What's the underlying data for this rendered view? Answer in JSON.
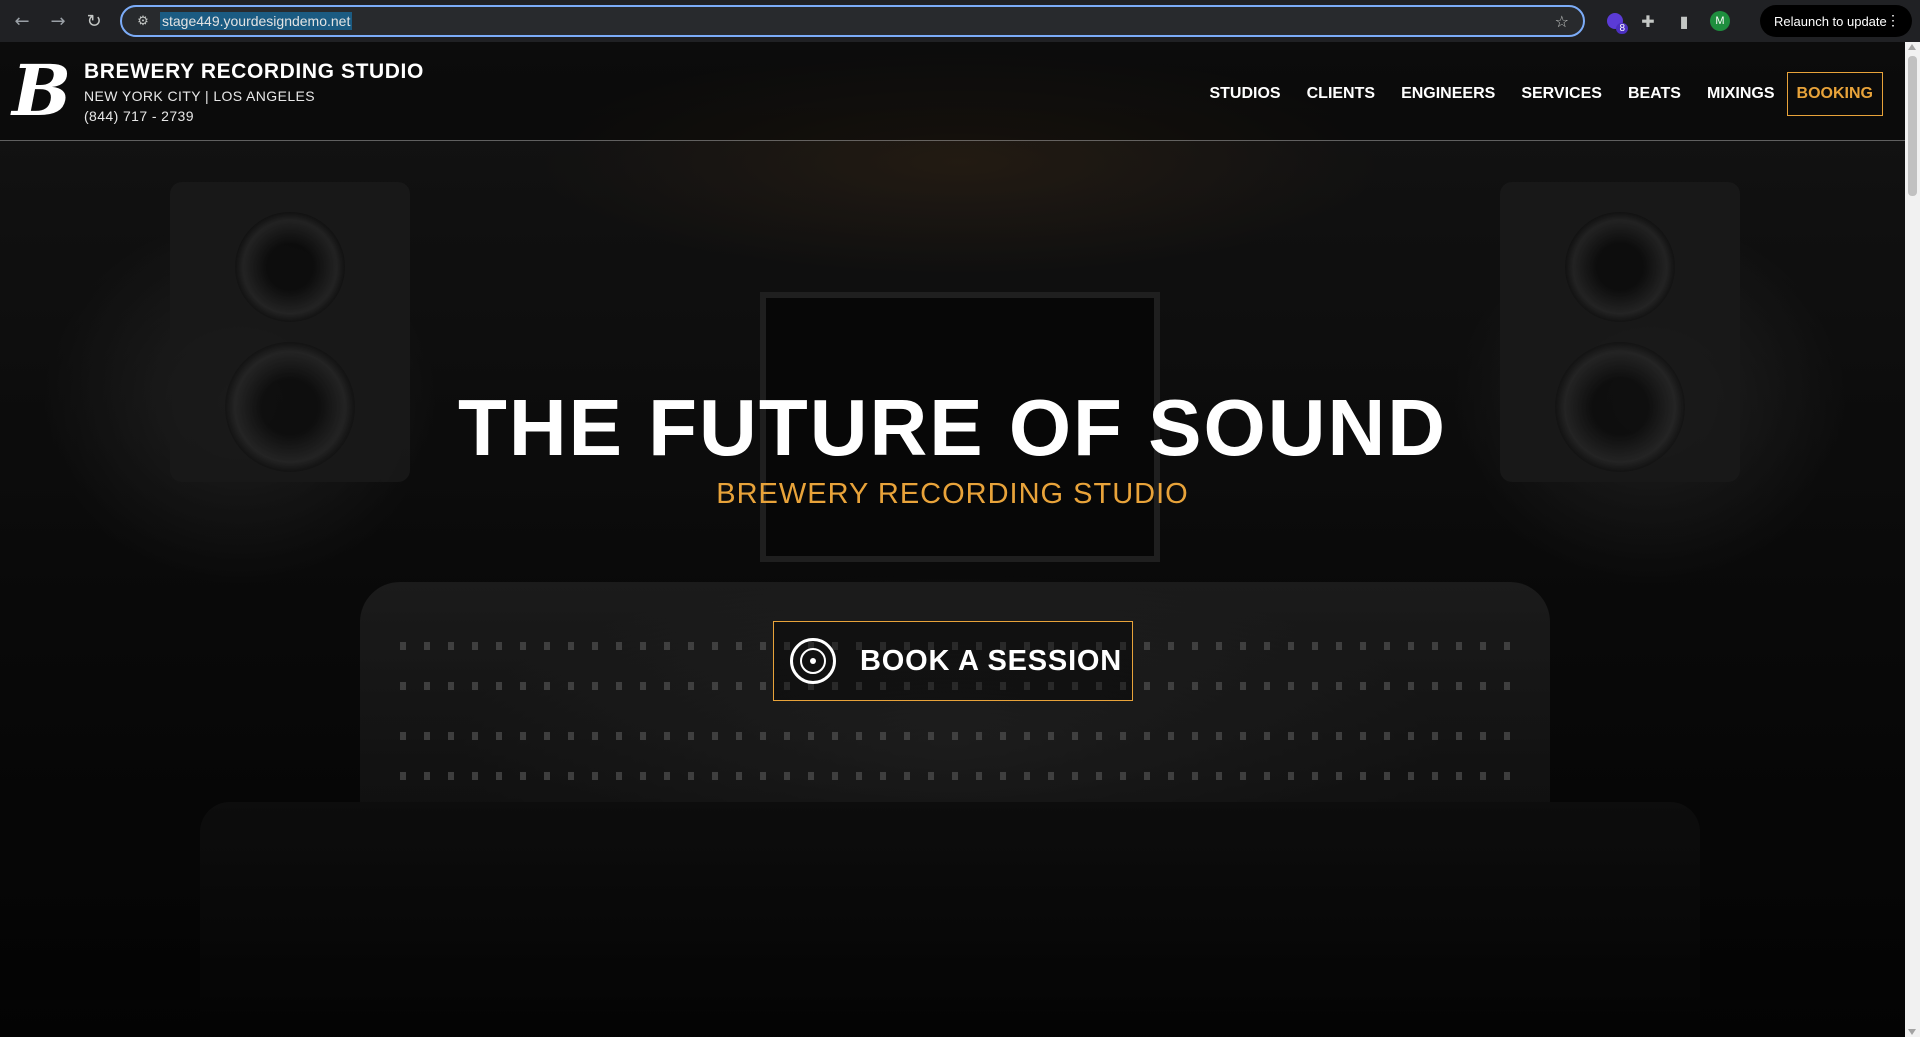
{
  "browser": {
    "url": "stage449.yourdesigndemo.net",
    "extension_badge_count": "8",
    "profile_initial": "M",
    "relaunch_label": "Relaunch to update",
    "icons": {
      "back": "arrow-left-icon",
      "forward": "arrow-right-icon",
      "reload": "reload-icon",
      "site_info": "tune-icon",
      "bookmark": "star-icon",
      "extensions": "puzzle-icon",
      "side_panel": "side-panel-icon",
      "menu": "more-vert-icon"
    }
  },
  "header": {
    "brand_name": "BREWERY RECORDING STUDIO",
    "brand_locations": "NEW YORK CITY | LOS ANGELES",
    "brand_phone": "(844) 717 - 2739",
    "logo_letter": "B",
    "nav": [
      {
        "label": "STUDIOS"
      },
      {
        "label": "CLIENTS"
      },
      {
        "label": "ENGINEERS"
      },
      {
        "label": "SERVICES"
      },
      {
        "label": "BEATS"
      },
      {
        "label": "MIXINGS"
      },
      {
        "label": "BOOKING"
      }
    ]
  },
  "hero": {
    "title": "THE FUTURE OF SOUND",
    "subtitle": "BREWERY RECORDING STUDIO",
    "cta_label": "BOOK A SESSION",
    "cta_icon": "vinyl-record-icon"
  },
  "colors": {
    "accent": "#e8a33a",
    "text": "#ffffff",
    "chrome_bg": "#202124",
    "omnibox_focus": "#7cacf8"
  }
}
